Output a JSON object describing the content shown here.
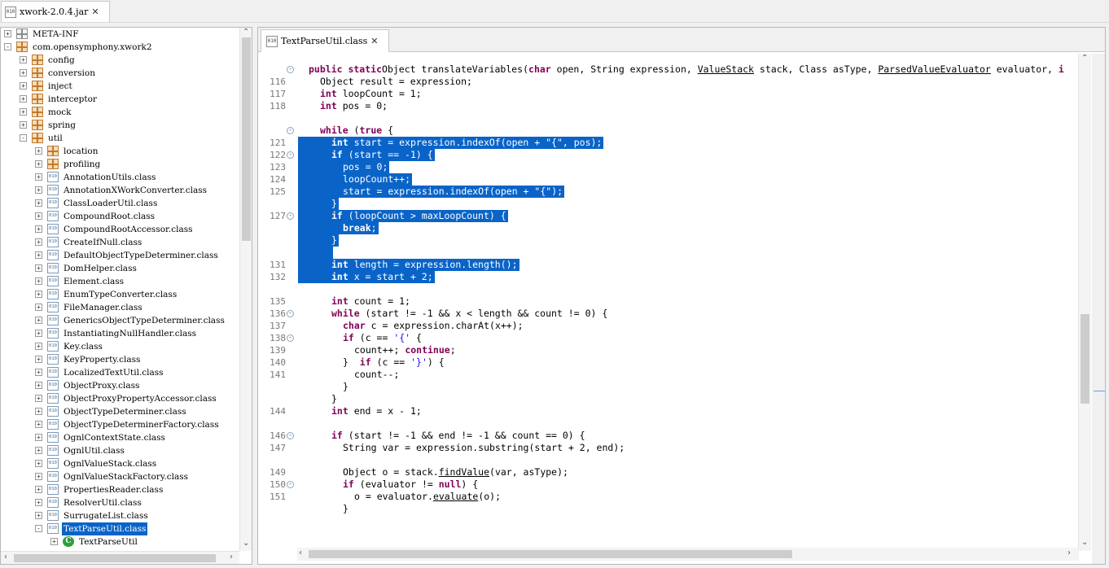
{
  "window": {
    "top_tab_label": "xwork-2.0.4.jar",
    "top_tab_icon": "jar-file-icon"
  },
  "tree": {
    "rows": [
      {
        "label": "META-INF",
        "icon": "folder-icon",
        "depth": 0,
        "exp": "+"
      },
      {
        "label": "com.opensymphony.xwork2",
        "icon": "package-icon",
        "depth": 0,
        "exp": "-"
      },
      {
        "label": "config",
        "icon": "package-icon",
        "depth": 1,
        "exp": "+"
      },
      {
        "label": "conversion",
        "icon": "package-icon",
        "depth": 1,
        "exp": "+"
      },
      {
        "label": "inject",
        "icon": "package-icon",
        "depth": 1,
        "exp": "+"
      },
      {
        "label": "interceptor",
        "icon": "package-icon",
        "depth": 1,
        "exp": "+"
      },
      {
        "label": "mock",
        "icon": "package-icon",
        "depth": 1,
        "exp": "+"
      },
      {
        "label": "spring",
        "icon": "package-icon",
        "depth": 1,
        "exp": "+"
      },
      {
        "label": "util",
        "icon": "package-icon",
        "depth": 1,
        "exp": "-"
      },
      {
        "label": "location",
        "icon": "package-icon",
        "depth": 2,
        "exp": "+"
      },
      {
        "label": "profiling",
        "icon": "package-icon",
        "depth": 2,
        "exp": "+"
      },
      {
        "label": "AnnotationUtils.class",
        "icon": "class-file-icon",
        "depth": 2,
        "exp": "+"
      },
      {
        "label": "AnnotationXWorkConverter.class",
        "icon": "class-file-icon",
        "depth": 2,
        "exp": "+"
      },
      {
        "label": "ClassLoaderUtil.class",
        "icon": "class-file-icon",
        "depth": 2,
        "exp": "+"
      },
      {
        "label": "CompoundRoot.class",
        "icon": "class-file-icon",
        "depth": 2,
        "exp": "+"
      },
      {
        "label": "CompoundRootAccessor.class",
        "icon": "class-file-icon",
        "depth": 2,
        "exp": "+"
      },
      {
        "label": "CreateIfNull.class",
        "icon": "class-file-icon",
        "depth": 2,
        "exp": "+"
      },
      {
        "label": "DefaultObjectTypeDeterminer.class",
        "icon": "class-file-icon",
        "depth": 2,
        "exp": "+"
      },
      {
        "label": "DomHelper.class",
        "icon": "class-file-icon",
        "depth": 2,
        "exp": "+"
      },
      {
        "label": "Element.class",
        "icon": "class-file-icon",
        "depth": 2,
        "exp": "+"
      },
      {
        "label": "EnumTypeConverter.class",
        "icon": "class-file-icon",
        "depth": 2,
        "exp": "+"
      },
      {
        "label": "FileManager.class",
        "icon": "class-file-icon",
        "depth": 2,
        "exp": "+"
      },
      {
        "label": "GenericsObjectTypeDeterminer.class",
        "icon": "class-file-icon",
        "depth": 2,
        "exp": "+"
      },
      {
        "label": "InstantiatingNullHandler.class",
        "icon": "class-file-icon",
        "depth": 2,
        "exp": "+"
      },
      {
        "label": "Key.class",
        "icon": "class-file-icon",
        "depth": 2,
        "exp": "+"
      },
      {
        "label": "KeyProperty.class",
        "icon": "class-file-icon",
        "depth": 2,
        "exp": "+"
      },
      {
        "label": "LocalizedTextUtil.class",
        "icon": "class-file-icon",
        "depth": 2,
        "exp": "+"
      },
      {
        "label": "ObjectProxy.class",
        "icon": "class-file-icon",
        "depth": 2,
        "exp": "+"
      },
      {
        "label": "ObjectProxyPropertyAccessor.class",
        "icon": "class-file-icon",
        "depth": 2,
        "exp": "+"
      },
      {
        "label": "ObjectTypeDeterminer.class",
        "icon": "class-file-icon",
        "depth": 2,
        "exp": "+"
      },
      {
        "label": "ObjectTypeDeterminerFactory.class",
        "icon": "class-file-icon",
        "depth": 2,
        "exp": "+"
      },
      {
        "label": "OgnlContextState.class",
        "icon": "class-file-icon",
        "depth": 2,
        "exp": "+"
      },
      {
        "label": "OgnlUtil.class",
        "icon": "class-file-icon",
        "depth": 2,
        "exp": "+"
      },
      {
        "label": "OgnlValueStack.class",
        "icon": "class-file-icon",
        "depth": 2,
        "exp": "+"
      },
      {
        "label": "OgnlValueStackFactory.class",
        "icon": "class-file-icon",
        "depth": 2,
        "exp": "+"
      },
      {
        "label": "PropertiesReader.class",
        "icon": "class-file-icon",
        "depth": 2,
        "exp": "+"
      },
      {
        "label": "ResolverUtil.class",
        "icon": "class-file-icon",
        "depth": 2,
        "exp": "+"
      },
      {
        "label": "SurrugateList.class",
        "icon": "class-file-icon",
        "depth": 2,
        "exp": "+"
      },
      {
        "label": "TextParseUtil.class",
        "icon": "class-file-icon",
        "depth": 2,
        "exp": "-",
        "selected": true
      },
      {
        "label": "TextParseUtil",
        "icon": "class-c-icon",
        "depth": 3,
        "exp": "+"
      }
    ]
  },
  "editor": {
    "tab_label": "TextParseUtil.class",
    "selection_color": "#0a64c8",
    "keyword_color": "#7f0055",
    "string_color": "#2a00ff",
    "lines": [
      {
        "row": 0,
        "num": "",
        "fold": "-",
        "indent": 0,
        "tokens": [
          [
            "kw",
            "public static"
          ],
          [
            "",
            "Object translateVariables("
          ],
          [
            "kw",
            "char"
          ],
          [
            "",
            " open, String expression, "
          ],
          [
            "ul",
            "ValueStack"
          ],
          [
            "",
            " stack, Class asType, "
          ],
          [
            "ul",
            "ParsedValueEvaluator"
          ],
          [
            "",
            " evaluator, "
          ],
          [
            "kw",
            "i"
          ]
        ]
      },
      {
        "row": 1,
        "num": "116",
        "indent": 1,
        "tokens": [
          [
            "",
            "Object result = expression;"
          ]
        ]
      },
      {
        "row": 2,
        "num": "117",
        "indent": 1,
        "tokens": [
          [
            "kw",
            "int"
          ],
          [
            "",
            " loopCount = 1;"
          ]
        ]
      },
      {
        "row": 3,
        "num": "118",
        "indent": 1,
        "tokens": [
          [
            "kw",
            "int"
          ],
          [
            "",
            " pos = 0;"
          ]
        ]
      },
      {
        "row": 5,
        "num": "",
        "fold": "-",
        "indent": 1,
        "tokens": [
          [
            "kw",
            "while"
          ],
          [
            "",
            " ("
          ],
          [
            "kw",
            "true"
          ],
          [
            "",
            " {"
          ]
        ]
      },
      {
        "row": 6,
        "num": "121",
        "indent": 2,
        "sel": true,
        "tokens": [
          [
            "kw",
            "int"
          ],
          [
            "",
            " start = expression.indexOf(open + "
          ],
          [
            "str",
            "\"{\""
          ],
          [
            "",
            ", pos);"
          ]
        ]
      },
      {
        "row": 7,
        "num": "122",
        "fold": "-",
        "indent": 2,
        "sel": true,
        "tokens": [
          [
            "kw",
            "if"
          ],
          [
            "",
            " (start == -1) {"
          ]
        ]
      },
      {
        "row": 8,
        "num": "123",
        "indent": 3,
        "sel": true,
        "tokens": [
          [
            "",
            "pos = 0;"
          ]
        ]
      },
      {
        "row": 9,
        "num": "124",
        "indent": 3,
        "sel": true,
        "tokens": [
          [
            "",
            "loopCount++;"
          ]
        ]
      },
      {
        "row": 10,
        "num": "125",
        "indent": 3,
        "sel": true,
        "tokens": [
          [
            "",
            "start = expression.indexOf(open + "
          ],
          [
            "str",
            "\"{\""
          ],
          [
            "",
            ");"
          ]
        ]
      },
      {
        "row": 11,
        "num": "",
        "indent": 2,
        "sel": true,
        "tokens": [
          [
            "",
            "}"
          ]
        ]
      },
      {
        "row": 12,
        "num": "127",
        "fold": "-",
        "indent": 2,
        "sel": true,
        "tokens": [
          [
            "kw",
            "if"
          ],
          [
            "",
            " (loopCount > maxLoopCount) {"
          ]
        ]
      },
      {
        "row": 13,
        "num": "",
        "indent": 3,
        "sel": true,
        "tokens": [
          [
            "kw",
            "break"
          ],
          [
            "",
            ";"
          ]
        ]
      },
      {
        "row": 14,
        "num": "",
        "indent": 2,
        "sel": true,
        "tokens": [
          [
            "",
            "}"
          ]
        ]
      },
      {
        "row": 15,
        "num": "",
        "indent": 2,
        "sel": true,
        "tokens": [
          [
            "",
            ""
          ]
        ]
      },
      {
        "row": 16,
        "num": "131",
        "indent": 2,
        "sel": true,
        "tokens": [
          [
            "kw",
            "int"
          ],
          [
            "",
            " length = expression.length();"
          ]
        ]
      },
      {
        "row": 17,
        "num": "132",
        "indent": 2,
        "sel": true,
        "tokens": [
          [
            "kw",
            "int"
          ],
          [
            "",
            " x = start + 2;"
          ]
        ]
      },
      {
        "row": 19,
        "num": "135",
        "indent": 2,
        "tokens": [
          [
            "kw",
            "int"
          ],
          [
            "",
            " count = 1;"
          ]
        ]
      },
      {
        "row": 20,
        "num": "136",
        "fold": "-",
        "indent": 2,
        "tokens": [
          [
            "kw",
            "while"
          ],
          [
            "",
            " (start != -1 && x < length && count != 0) {"
          ]
        ]
      },
      {
        "row": 21,
        "num": "137",
        "indent": 3,
        "tokens": [
          [
            "kw",
            "char"
          ],
          [
            "",
            " c = expression.charAt(x++);"
          ]
        ]
      },
      {
        "row": 22,
        "num": "138",
        "fold": "-",
        "indent": 3,
        "tokens": [
          [
            "kw",
            "if"
          ],
          [
            "",
            " (c == "
          ],
          [
            "str",
            "'{'"
          ],
          [
            "",
            " {"
          ]
        ]
      },
      {
        "row": 23,
        "num": "139",
        "indent": 4,
        "tokens": [
          [
            "",
            "count++; "
          ],
          [
            "kw",
            "continue"
          ],
          [
            "",
            ";"
          ]
        ]
      },
      {
        "row": 24,
        "num": "140",
        "indent": 3,
        "tokens": [
          [
            "",
            "}  "
          ],
          [
            "kw",
            "if"
          ],
          [
            "",
            " (c == "
          ],
          [
            "str",
            "'}'"
          ],
          [
            "",
            ") {"
          ]
        ]
      },
      {
        "row": 25,
        "num": "141",
        "indent": 4,
        "tokens": [
          [
            "",
            "count--;"
          ]
        ]
      },
      {
        "row": 26,
        "num": "",
        "indent": 3,
        "tokens": [
          [
            "",
            "}"
          ]
        ]
      },
      {
        "row": 27,
        "num": "",
        "indent": 2,
        "tokens": [
          [
            "",
            "}"
          ]
        ]
      },
      {
        "row": 28,
        "num": "144",
        "indent": 2,
        "tokens": [
          [
            "kw",
            "int"
          ],
          [
            "",
            " end = x - 1;"
          ]
        ]
      },
      {
        "row": 30,
        "num": "146",
        "fold": "-",
        "indent": 2,
        "tokens": [
          [
            "kw",
            "if"
          ],
          [
            "",
            " (start != -1 && end != -1 && count == 0) {"
          ]
        ]
      },
      {
        "row": 31,
        "num": "147",
        "indent": 3,
        "tokens": [
          [
            "",
            "String var = expression.substring(start + 2, end);"
          ]
        ]
      },
      {
        "row": 33,
        "num": "149",
        "indent": 3,
        "tokens": [
          [
            "",
            "Object o = stack."
          ],
          [
            "ul",
            "findValue"
          ],
          [
            "",
            "(var, asType);"
          ]
        ]
      },
      {
        "row": 34,
        "num": "150",
        "fold": "-",
        "indent": 3,
        "tokens": [
          [
            "kw",
            "if"
          ],
          [
            "",
            " (evaluator != "
          ],
          [
            "kw",
            "null"
          ],
          [
            "",
            ") {"
          ]
        ]
      },
      {
        "row": 35,
        "num": "151",
        "indent": 4,
        "tokens": [
          [
            "",
            "o = evaluator."
          ],
          [
            "ul",
            "evaluate"
          ],
          [
            "",
            "(o);"
          ]
        ]
      },
      {
        "row": 36,
        "num": "",
        "indent": 3,
        "tokens": [
          [
            "",
            "}"
          ]
        ]
      }
    ]
  }
}
